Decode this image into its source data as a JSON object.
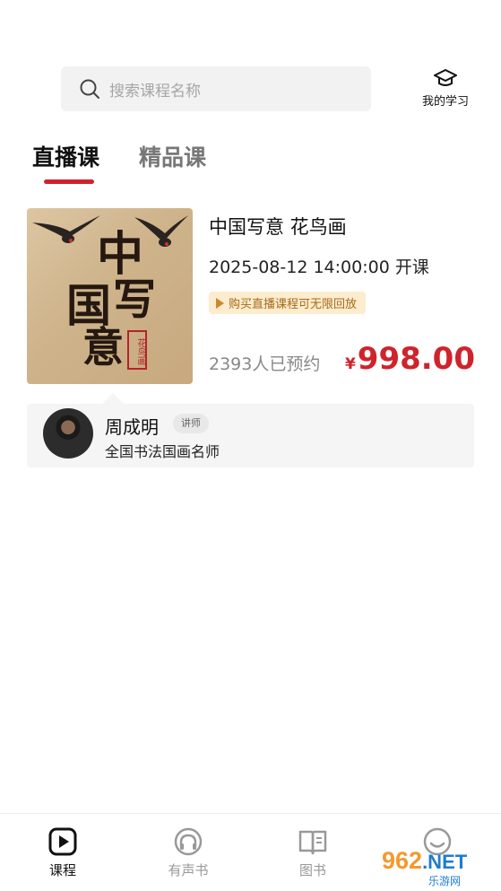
{
  "search": {
    "placeholder": "搜索课程名称"
  },
  "header": {
    "my_study_label": "我的学习"
  },
  "tabs": [
    {
      "label": "直播课"
    },
    {
      "label": "精品课"
    }
  ],
  "course": {
    "cover": {
      "calligraphy": [
        "中",
        "国",
        "写",
        "意"
      ],
      "seal": "花鸟画"
    },
    "title": "中国写意 花鸟画",
    "start_time": "2025-08-12 14:00:00 开课",
    "replay_badge": "购买直播课程可无限回放",
    "reserved_count": "2393人已预约",
    "price_currency": "¥",
    "price": "998.00"
  },
  "teacher": {
    "name": "周成明",
    "tag": "讲师",
    "description": "全国书法国画名师"
  },
  "nav": [
    {
      "label": "课程",
      "icon": "play-square-icon"
    },
    {
      "label": "有声书",
      "icon": "headphones-icon"
    },
    {
      "label": "图书",
      "icon": "book-icon"
    },
    {
      "label": "",
      "icon": "smile-icon"
    }
  ],
  "watermark": {
    "main": "962",
    "suffix": ".NET",
    "sub": "乐游网"
  },
  "colors": {
    "accent": "#d0232b",
    "badge_bg": "#fdeccd",
    "badge_text": "#a46b1c"
  }
}
